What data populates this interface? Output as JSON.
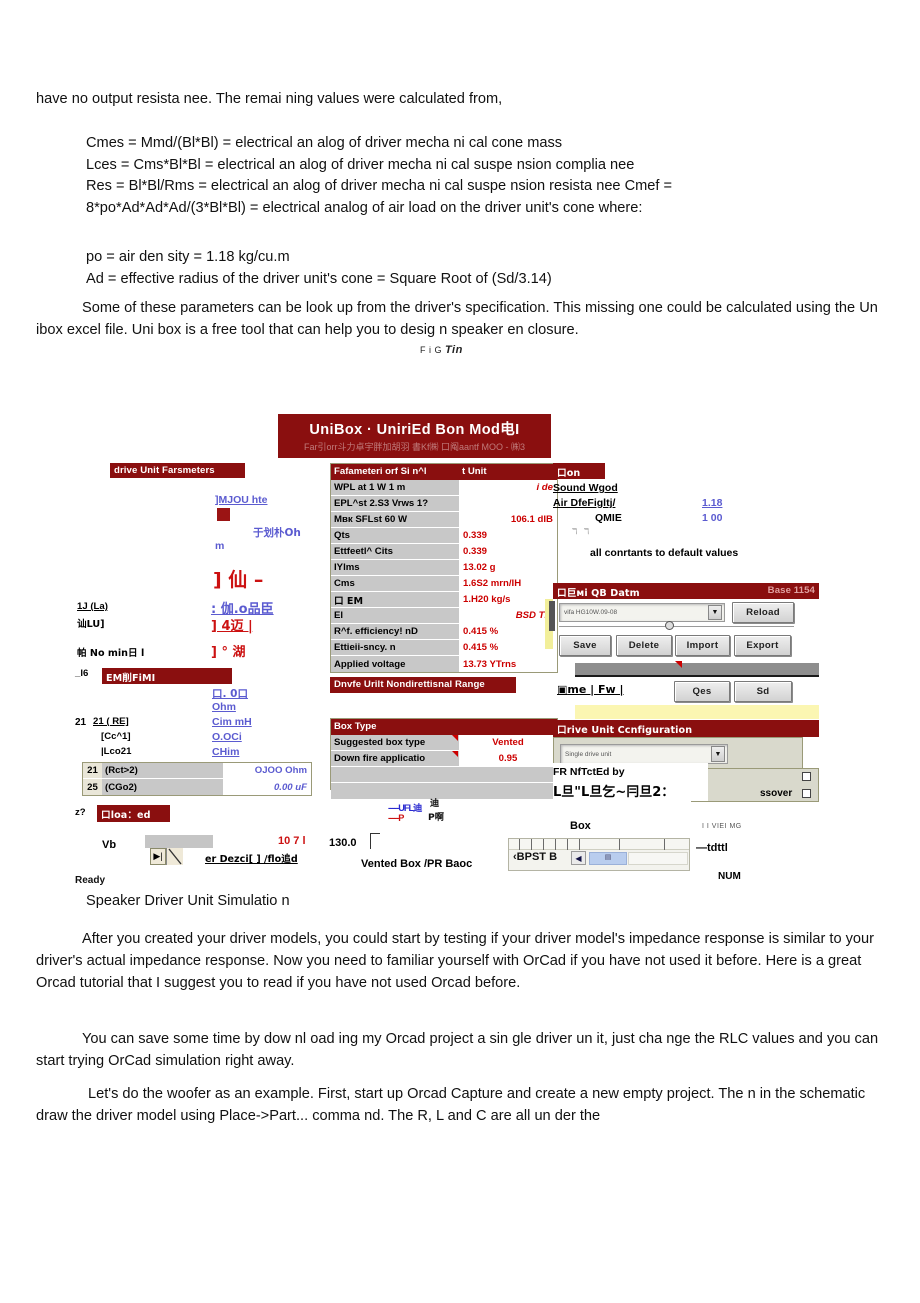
{
  "document": {
    "paragraphs": [
      {
        "id": "p1",
        "text": "have no output resista nee. The remai ning values were calculated from,"
      },
      {
        "id": "p3",
        "text": "Some of these parameters can be look up from the driver's specification. This missing one could be calculated using the Un ibox excel file. Uni box is a free tool that can help you to desig n speaker en closure."
      },
      {
        "id": "p4",
        "text": "After you created your driver models, you could start by testing if your driver model's impedance response is similar to your driver's actual impedance response. Now you need to familiar yourself with OrCad if you have not used it before. Here is a great Orcad tutorial that I suggest you to read if you have not used Orcad before."
      },
      {
        "id": "p5",
        "text": "You can save some time by dow nl oad ing my Orcad project a sin gle driver un it, just cha nge the RLC values and you can start trying OrCad simulation right away."
      },
      {
        "id": "p6",
        "text": "Let's do the woofer as an example. First, start up Orcad Capture and create a new empty project. The n in the schematic draw the driver model using Place->Part... comma nd. The R, L and C are all un der the"
      }
    ],
    "formula_block_1": [
      "Cmes = Mmd/(Bl*Bl) = electrical an alog of driver mecha ni cal cone mass",
      "Lces = Cms*Bl*Bl = electrical an alog of driver mecha ni cal suspe nsion complia nee",
      "Res = Bl*Bl/Rms = electrical an alog of driver mecha ni cal suspe nsion resista nee Cmef =",
      "8*po*Ad*Ad*Ad/(3*Bl*Bl) = electrical analog of air load on the driver unit's cone where:"
    ],
    "formula_block_2": [
      "po = air den sity = 1.18 kg/cu.m",
      "Ad = effective radius of the driver unit's cone = Square Root of (Sd/3.14)"
    ],
    "figure_marker": {
      "prefix": "F i G ",
      "italic": "Tin"
    },
    "figure_caption": "Speaker Driver Unit Simulatio n"
  },
  "unibox": {
    "title": "UniBox  ·  UniriEd Bon Mod电I",
    "subtitle": "Far引orr斗力卓宇胖加胡羽 書Kf㈱ 口阄aantf MOO - ㈱3",
    "left_panel": {
      "header": "drive Unit Farsmeters",
      "labels": {
        "mjou": "]MJOU hte",
        "ohm_cjk": "于划朴Oh",
        "m": "m",
        "big_cjk": "]  仙  –",
        "la_label": "1J (La)",
        "lu_label": "讪LU]",
        "row_colon": ":  伽.o品臣",
        "row_bracket": "]     4迈 |",
        "nomin": "帕 No min日 l",
        "deg": "]    °    湖"
      }
    },
    "emi_panel": {
      "prefix": "_l6",
      "header": "EM削FiMI",
      "rows_labels": [
        "21  ( RE]",
        "[Cc^1]",
        "|Lco21"
      ],
      "rows_values": [
        "口. 0口",
        "Ohm",
        "Cim mH",
        "O.OCi",
        "CHim"
      ],
      "table": [
        {
          "num": "21",
          "label": "(Rct>2)",
          "value": "OJOO Ohm",
          "italic": false
        },
        {
          "num": "25",
          "label": "(CGo2)",
          "value": "0.00 uF",
          "italic": true
        }
      ],
      "z_prefix": "z?",
      "loaded_header": "口loa：ed"
    },
    "vb": {
      "label": "Vb",
      "value": "10 7 l",
      "link": "er Dezci[ ] /flo追d",
      "ready": "Ready"
    },
    "params_table": {
      "header_left": "Fafameteri orf Si n^l",
      "header_right": "t Unit",
      "rows": [
        {
          "label": "WPL at 1 W 1 m",
          "value": "i de",
          "italic": true
        },
        {
          "label": "EPL^st 2.S3 Vrws 1?",
          "value": "",
          "italic": false
        },
        {
          "label": "Mвк SFLst 60 W",
          "value": "106.1 dIB",
          "italic": false
        },
        {
          "label": "Qts",
          "value": "0.339",
          "italic": false
        },
        {
          "label": "Ettfeetl^ Cits",
          "value": "0.339",
          "italic": false
        },
        {
          "label": "IYlms",
          "value": "13.02 g",
          "italic": false
        },
        {
          "label": "Cms",
          "value": "1.6S2 mrn/IH",
          "italic": false
        },
        {
          "label": "口   ЕМ",
          "value": "1.H20 kg/s",
          "italic": false
        },
        {
          "label": "El",
          "value": "BSD Tm",
          "italic": true
        },
        {
          "label": "R^f. efficiency! nD",
          "value": "0.415 %",
          "italic": false
        },
        {
          "label": "Ettieii-sncy. n",
          "value": "0.415 %",
          "italic": false
        },
        {
          "label": "Applied voltage",
          "value": "13.73 YTrns",
          "italic": false
        }
      ]
    },
    "nondirectional_header": "Dnvfe Urilt Nondirettisnal Range",
    "box_type": {
      "header": "Box Type",
      "rows": [
        {
          "label": "Suggested box type",
          "value": "Vented"
        },
        {
          "label": "Down fire applicatio",
          "value": "0.95"
        },
        {
          "label": "",
          "value": ""
        },
        {
          "label": "",
          "value": ""
        }
      ]
    },
    "graph": {
      "legend_1": "-----UFL迪",
      "legend_1b": "迪",
      "legend_2": "-----P",
      "legend_2b": "P啊",
      "y_max": "130.0",
      "caption": "Vented Box /PR Baoc"
    },
    "constants": {
      "header": "口on",
      "line1": "Sound Wgod",
      "line2": "Air DfeFigltj/",
      "line3": "QMIE",
      "value1": "1.18",
      "value2": "1 00",
      "note": "all conrtants to default values"
    },
    "qb_data": {
      "header": "口巨мi QB Datm",
      "badge": "Base  1154",
      "combo_value": "vifa HG10W.09-08",
      "reload_button": "Reload",
      "buttons": [
        "Save",
        "Delete",
        "Import",
        "Export"
      ],
      "link": "me |      Fw |",
      "small_buttons": [
        "Qes",
        "Sd"
      ]
    },
    "drive_config": {
      "header": "口rive Unit Ccnfiguration",
      "combo_value": "Single drive unit",
      "label1": "FR NfTctEd by",
      "label2": "L旦\"L旦乞~冃旦2：",
      "right_label": "ssover"
    },
    "bottom": {
      "box_label": "Box",
      "tiny_label": "I I VIEI MG",
      "tdttl": "—tdttl",
      "num": "NUM",
      "sheet_tab": "BPST B"
    }
  }
}
